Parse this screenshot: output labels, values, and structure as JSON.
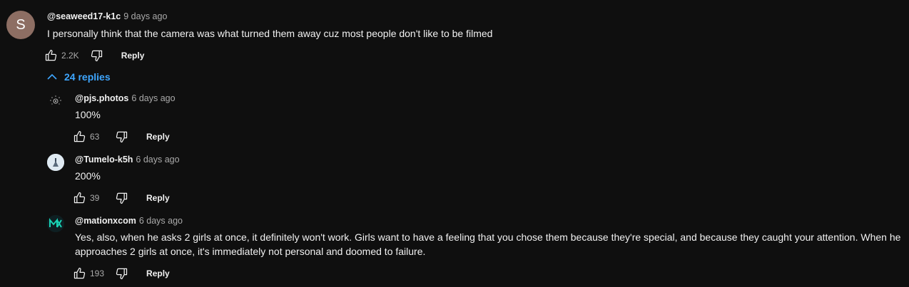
{
  "top_comment": {
    "avatar_letter": "S",
    "author": "@seaweed17-k1c",
    "time": "9 days ago",
    "text": "I personally think that the camera was what turned them away cuz most people don't like to be filmed",
    "likes": "2.2K",
    "reply_label": "Reply"
  },
  "replies_toggle": {
    "label": "24 replies"
  },
  "replies": [
    {
      "author": "@pjs.photos",
      "time": "6 days ago",
      "text_lines": [
        "100%"
      ],
      "likes": "63",
      "reply_label": "Reply"
    },
    {
      "author": "@Tumelo-k5h",
      "time": "6 days ago",
      "text_lines": [
        "200%"
      ],
      "likes": "39",
      "reply_label": "Reply"
    },
    {
      "author": "@mationxcom",
      "time": "6 days ago",
      "text_lines": [
        "Yes, also, when he asks 2 girls at once, it definitely won't work. Girls want to have a feeling that you chose them because they're special, and because they caught your attention. When he",
        "approaches 2 girls at once, it's immediately not personal and doomed to failure."
      ],
      "likes": "193",
      "reply_label": "Reply"
    }
  ],
  "icons": {
    "like": "thumb-up-icon",
    "dislike": "thumb-down-icon",
    "toggle": "chevron-up-icon"
  },
  "colors": {
    "background": "#0f0f0f",
    "link": "#3ea6ff",
    "avatar_bg": "#8d6e63"
  }
}
